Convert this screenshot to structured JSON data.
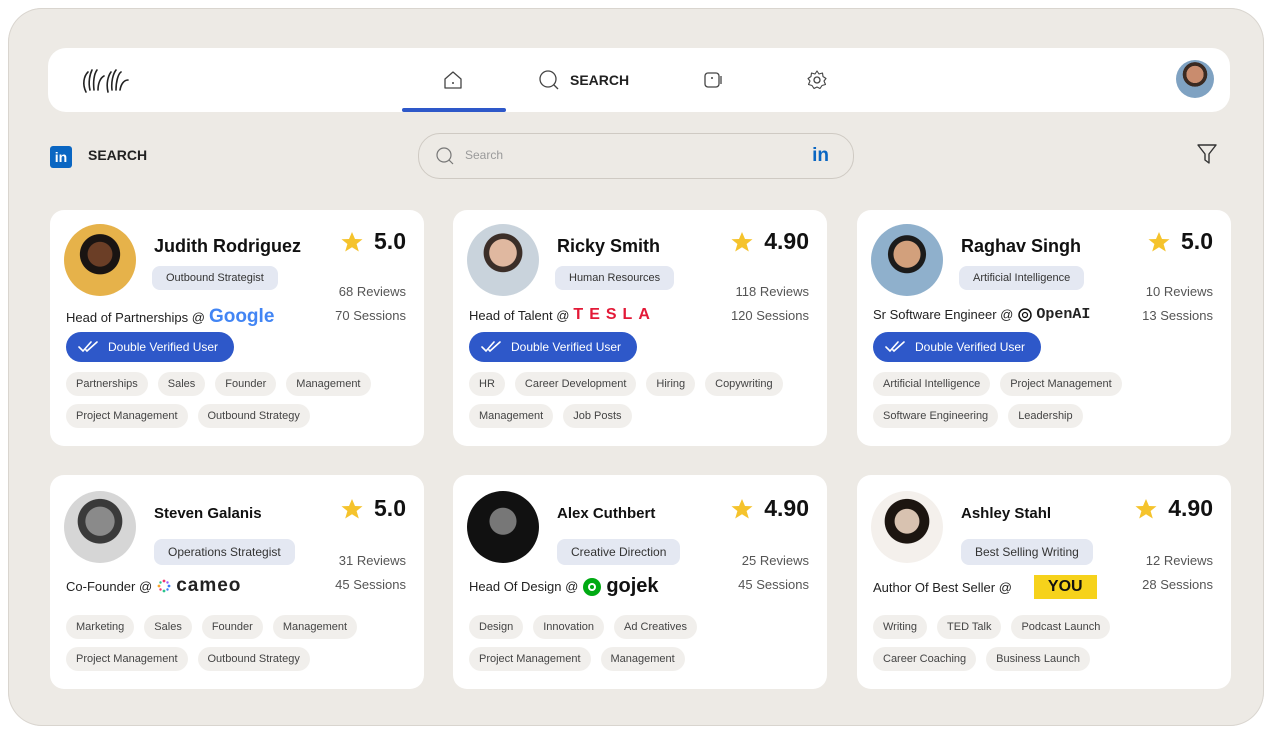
{
  "nav": {
    "search_label": "SEARCH",
    "icons": [
      "hand-wave-logo-icon",
      "home-icon",
      "search-icon",
      "messages-icon",
      "settings-icon"
    ]
  },
  "subheader": {
    "source_label": "SEARCH",
    "search_placeholder": "Search",
    "search_brand": "in"
  },
  "cards": [
    {
      "name": "Judith Rodriguez",
      "role": "Outbound Strategist",
      "rating": "5.0",
      "reviews": "68 Reviews",
      "sessions": "70 Sessions",
      "headline": "Head of Partnerships @",
      "company": "Google",
      "verified": "Double Verified User",
      "tags": [
        "Partnerships",
        "Sales",
        "Founder",
        "Management",
        "Project Management",
        "Outbound Strategy"
      ]
    },
    {
      "name": "Ricky Smith",
      "role": "Human Resources",
      "rating": "4.90",
      "reviews": "118 Reviews",
      "sessions": "120 Sessions",
      "headline": "Head of Talent @",
      "company": "TESLA",
      "verified": "Double Verified User",
      "tags": [
        "HR",
        "Career Development",
        "Hiring",
        "Copywriting",
        "Management",
        "Job Posts"
      ]
    },
    {
      "name": "Raghav Singh",
      "role": "Artificial Intelligence",
      "rating": "5.0",
      "reviews": "10 Reviews",
      "sessions": "13 Sessions",
      "headline": "Sr Software Engineer @",
      "company": "OpenAI",
      "verified": "Double Verified User",
      "tags": [
        "Artificial Intelligence",
        "Project Management",
        "Software Engineering",
        "Leadership"
      ]
    },
    {
      "name": "Steven Galanis",
      "role": "Operations Strategist",
      "rating": "5.0",
      "reviews": "31 Reviews",
      "sessions": "45 Sessions",
      "headline": "Co-Founder @",
      "company": "cameo",
      "tags": [
        "Marketing",
        "Sales",
        "Founder",
        "Management",
        "Project Management",
        "Outbound Strategy"
      ]
    },
    {
      "name": "Alex Cuthbert",
      "role": "Creative Direction",
      "rating": "4.90",
      "reviews": "25 Reviews",
      "sessions": "45 Sessions",
      "headline": "Head Of Design @",
      "company": "gojek",
      "tags": [
        "Design",
        "Innovation",
        "Ad Creatives",
        "Project Management",
        "Management"
      ]
    },
    {
      "name": "Ashley Stahl",
      "role": "Best Selling Writing",
      "rating": "4.90",
      "reviews": "12 Reviews",
      "sessions": "28 Sessions",
      "headline": "Author Of Best Seller @",
      "company": "YOU",
      "tags": [
        "Writing",
        "TED Talk",
        "Podcast Launch",
        "Career Coaching",
        "Business Launch"
      ]
    }
  ],
  "colors": {
    "accent": "#2e58c9",
    "linkedin": "#0a66c2",
    "star": "#f5c32c",
    "background": "#edeae5"
  }
}
